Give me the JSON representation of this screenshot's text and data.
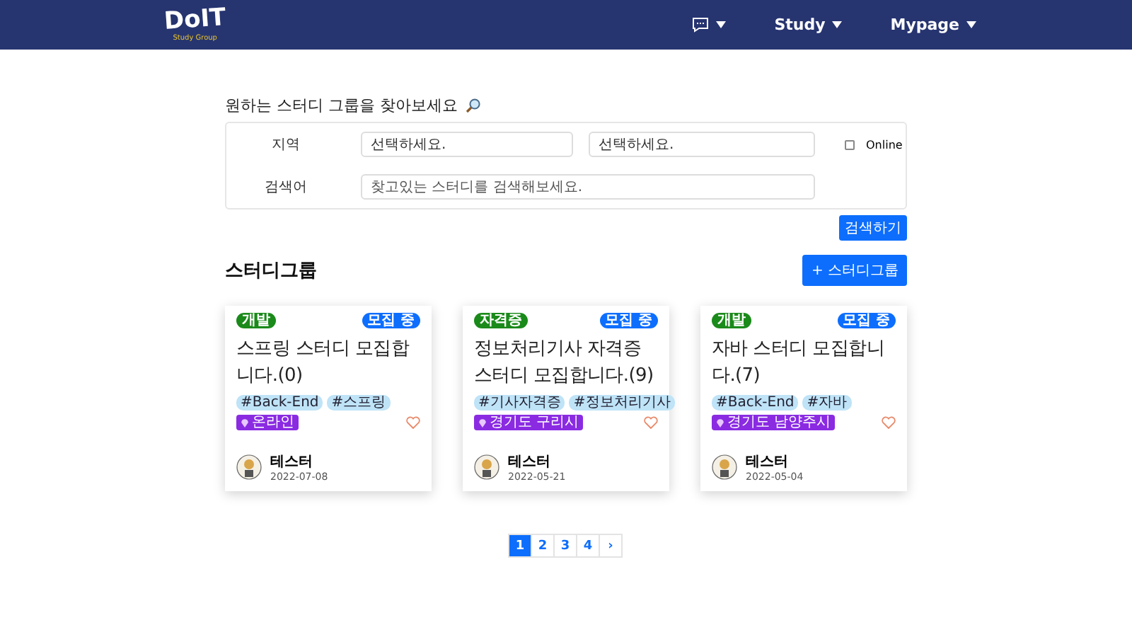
{
  "nav": {
    "logo": "DoIT",
    "logo_sub": "Study Group",
    "menus": [
      {
        "kind": "icon"
      },
      {
        "kind": "text",
        "label": "Study"
      },
      {
        "kind": "text",
        "label": "Mypage"
      }
    ]
  },
  "search": {
    "heading": "원하는 스터디 그룹을 찾아보세요",
    "region_label": "지역",
    "region_selects": [
      {
        "value": "선택하세요."
      },
      {
        "value": "선택하세요."
      }
    ],
    "online": {
      "label": "Online",
      "checked": false
    },
    "keyword_label": "검색어",
    "keyword": {
      "placeholder": "찾고있는 스터디를 검색해보세요."
    },
    "button": "검색하기"
  },
  "groups": {
    "title": "스터디그룹",
    "add_button": "+ 스터디그룹",
    "cards": [
      {
        "category": "개발",
        "status": "모집 중",
        "title": "스프링 스터디 모집합니다.(0)",
        "tags": [
          "#Back-End",
          "#스프링"
        ],
        "location": "온라인",
        "liked": false,
        "author": "테스터",
        "date": "2022-07-08"
      },
      {
        "category": "자격증",
        "status": "모집 중",
        "title": "정보처리기사 자격증 스터디 모집합니다.(9)",
        "tags": [
          "#기사자격증",
          "#정보처리기사"
        ],
        "location": "경기도 구리시",
        "liked": false,
        "author": "테스터",
        "date": "2022-05-21"
      },
      {
        "category": "개발",
        "status": "모집 중",
        "title": "자바 스터디 모집합니다.(7)",
        "tags": [
          "#Back-End",
          "#자바"
        ],
        "location": "경기도 남양주시",
        "liked": false,
        "author": "테스터",
        "date": "2022-05-04"
      }
    ]
  },
  "pagination": {
    "pages": [
      {
        "label": "1",
        "selected": true
      },
      {
        "label": "2",
        "selected": false
      },
      {
        "label": "3",
        "selected": false
      },
      {
        "label": "4",
        "selected": false
      }
    ],
    "next": "›"
  }
}
